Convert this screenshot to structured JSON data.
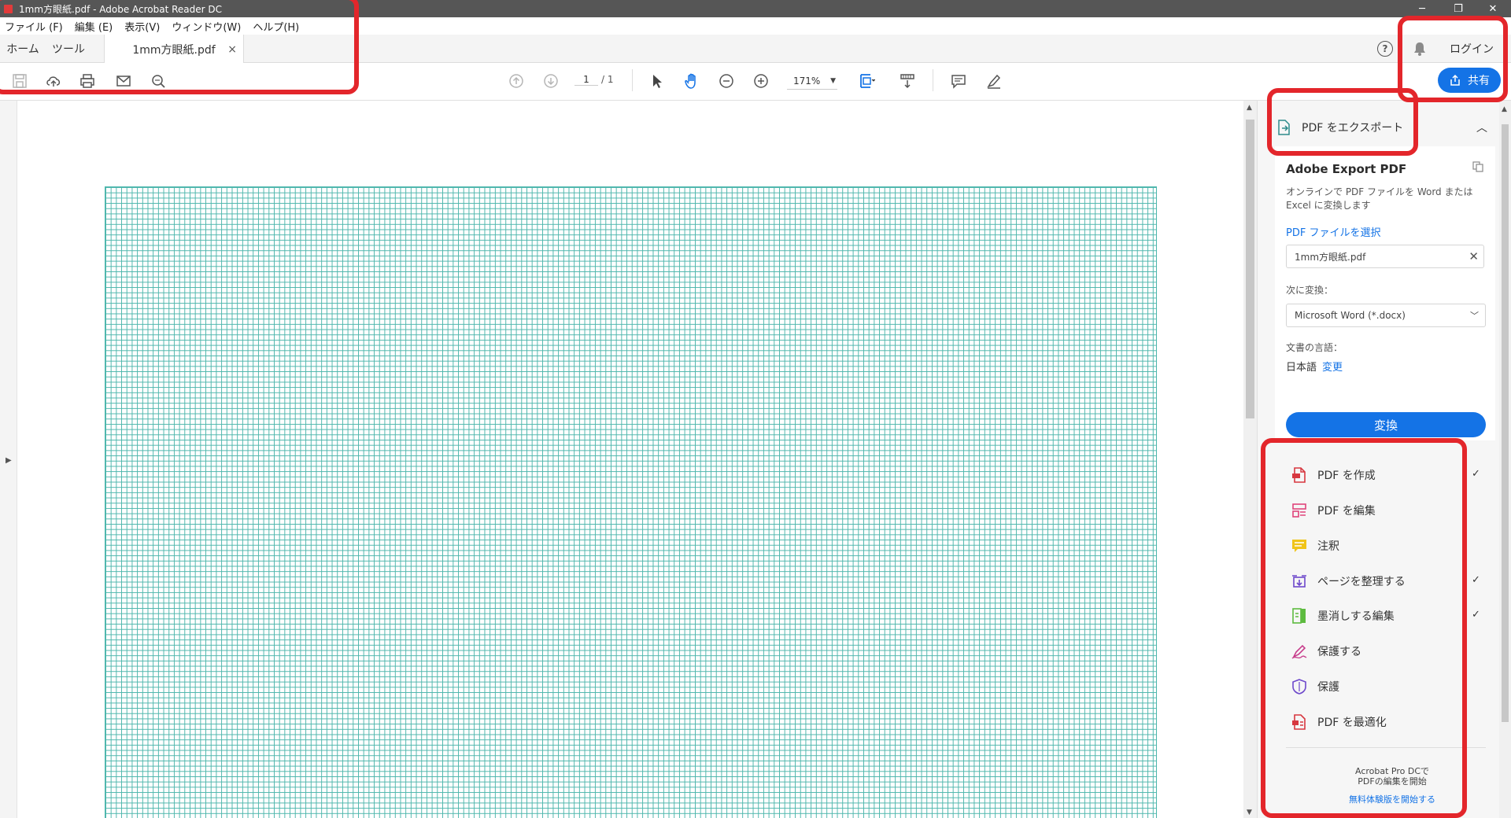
{
  "window": {
    "title": "1mm方眼紙.pdf - Adobe Acrobat Reader DC",
    "minimize": "─",
    "restore": "❐",
    "close": "✕"
  },
  "menu": {
    "items": [
      "ファイル (F)",
      "編集 (E)",
      "表示(V)",
      "ウィンドウ(W)",
      "ヘルプ(H)"
    ]
  },
  "tabs": {
    "home": "ホーム",
    "tools": "ツール",
    "document": "1mm方眼紙.pdf",
    "close": "×"
  },
  "header": {
    "help": "?",
    "signin": "ログイン"
  },
  "toolbar": {
    "page_current": "1",
    "page_total": "/ 1",
    "zoom": "171%",
    "share_label": "共有"
  },
  "right_panel": {
    "export_header": "PDF をエクスポート",
    "title": "Adobe Export PDF",
    "description": "オンラインで PDF ファイルを Word または Excel に変換します",
    "select_pdf": "PDF ファイルを選択",
    "file_name": "1mm方眼紙.pdf",
    "convert_to_label": "次に変換：",
    "format": "Microsoft Word (*.docx)",
    "language_label": "文書の言語：",
    "language": "日本語",
    "language_change": "変更",
    "convert_button": "変換",
    "tools": [
      {
        "label": "PDF を作成",
        "icon": "create-pdf-icon",
        "checked": true
      },
      {
        "label": "PDF を編集",
        "icon": "edit-pdf-icon",
        "checked": false
      },
      {
        "label": "注釈",
        "icon": "comment-icon",
        "checked": false
      },
      {
        "label": "ページを整理する",
        "icon": "organize-pages-icon",
        "checked": true
      },
      {
        "label": "墨消しする編集",
        "icon": "redact-icon",
        "checked": true
      },
      {
        "label": "保護する",
        "icon": "sign-icon",
        "checked": false
      },
      {
        "label": "保護",
        "icon": "protect-icon",
        "checked": false
      },
      {
        "label": "PDF を最適化",
        "icon": "optimize-pdf-icon",
        "checked": false
      }
    ],
    "promo_line1": "Acrobat Pro DCで",
    "promo_line2": "PDFの編集を開始",
    "promo_link": "無料体験版を開始する"
  },
  "colors": {
    "accent": "#1473e6",
    "grid": "#4db6ac",
    "annotation": "#e3262b"
  }
}
